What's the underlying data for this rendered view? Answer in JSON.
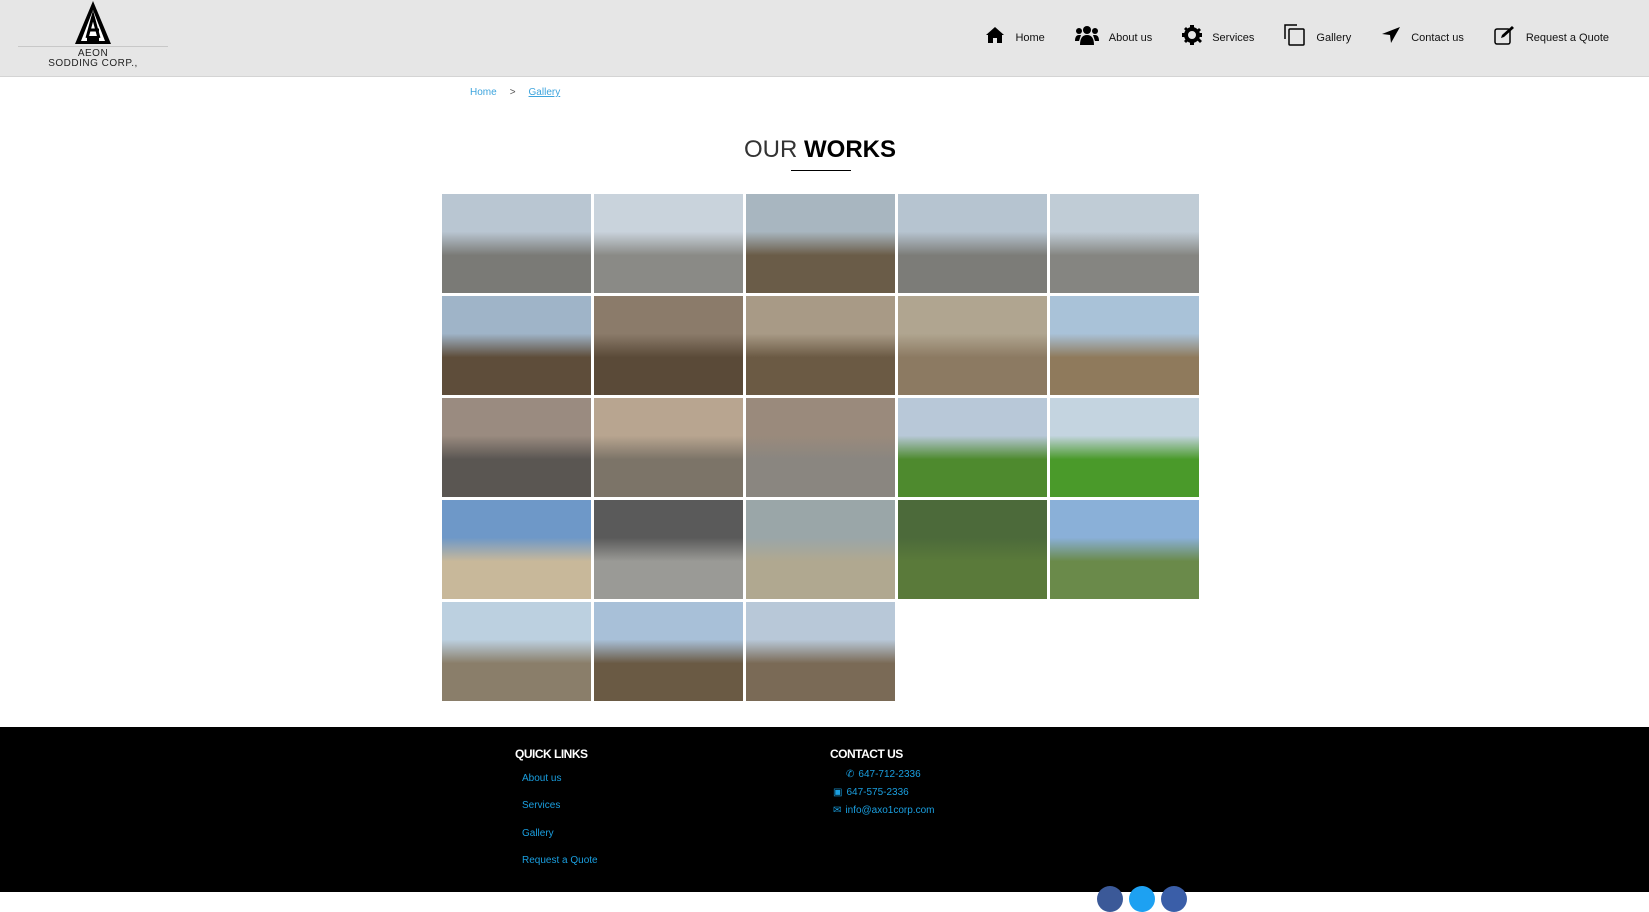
{
  "logo": {
    "line1": "AEON",
    "line2": "SODDING CORP.,",
    "mark": "EON"
  },
  "nav": [
    {
      "label": "Home",
      "icon": "home-icon"
    },
    {
      "label": "About us",
      "icon": "users-icon"
    },
    {
      "label": "Services",
      "icon": "gear-icon"
    },
    {
      "label": "Gallery",
      "icon": "copy-icon"
    },
    {
      "label": "Contact us",
      "icon": "location-arrow-icon"
    },
    {
      "label": "Request a Quote",
      "icon": "edit-icon"
    }
  ],
  "breadcrumb": {
    "home": "Home",
    "sep": ">",
    "current": "Gallery"
  },
  "title": {
    "light": "OUR",
    "bold": "WORKS"
  },
  "gallery": [
    [
      "#b9c6d2",
      "#7a7a76"
    ],
    [
      "#c9d3dc",
      "#8a8a86"
    ],
    [
      "#a8b6c0",
      "#6a5c48"
    ],
    [
      "#b6c4d0",
      "#7c7c78"
    ],
    [
      "#c0ccd6",
      "#858581"
    ],
    [
      "#9fb4c8",
      "#5e4d3a"
    ],
    [
      "#8b7b6a",
      "#5a4a38"
    ],
    [
      "#a89a86",
      "#6b5a44"
    ],
    [
      "#b0a590",
      "#8c7a62"
    ],
    [
      "#a9c2d8",
      "#8f7a5c"
    ],
    [
      "#9a8b80",
      "#5a5652"
    ],
    [
      "#b8a590",
      "#7c7468"
    ],
    [
      "#9a8a7c",
      "#8a8680"
    ],
    [
      "#b8c8d8",
      "#4e8a2e"
    ],
    [
      "#c4d4e0",
      "#4a9a2a"
    ],
    [
      "#6e98c8",
      "#c8b89a"
    ],
    [
      "#5a5a5a",
      "#9a9a96"
    ],
    [
      "#9aa6a8",
      "#b0a890"
    ],
    [
      "#4c6a3a",
      "#5a7a3a"
    ],
    [
      "#8ab0d8",
      "#6a8a4a"
    ],
    [
      "#bcd0e0",
      "#8a7e6a"
    ],
    [
      "#a8c0d8",
      "#6a5a44"
    ],
    [
      "#b8c8d8",
      "#7a6a56"
    ]
  ],
  "footer": {
    "quick_links_title": "QUICK LINKS",
    "links": [
      "About us",
      "Services",
      "Gallery",
      "Request a Quote"
    ],
    "contact_title": "CONTACT US",
    "phone": "647-712-2336",
    "fax": "647-575-2336",
    "email": "info@axo1corp.com",
    "social_colors": [
      "#3b5998",
      "#1da1f2",
      "#3a5ea8"
    ]
  }
}
